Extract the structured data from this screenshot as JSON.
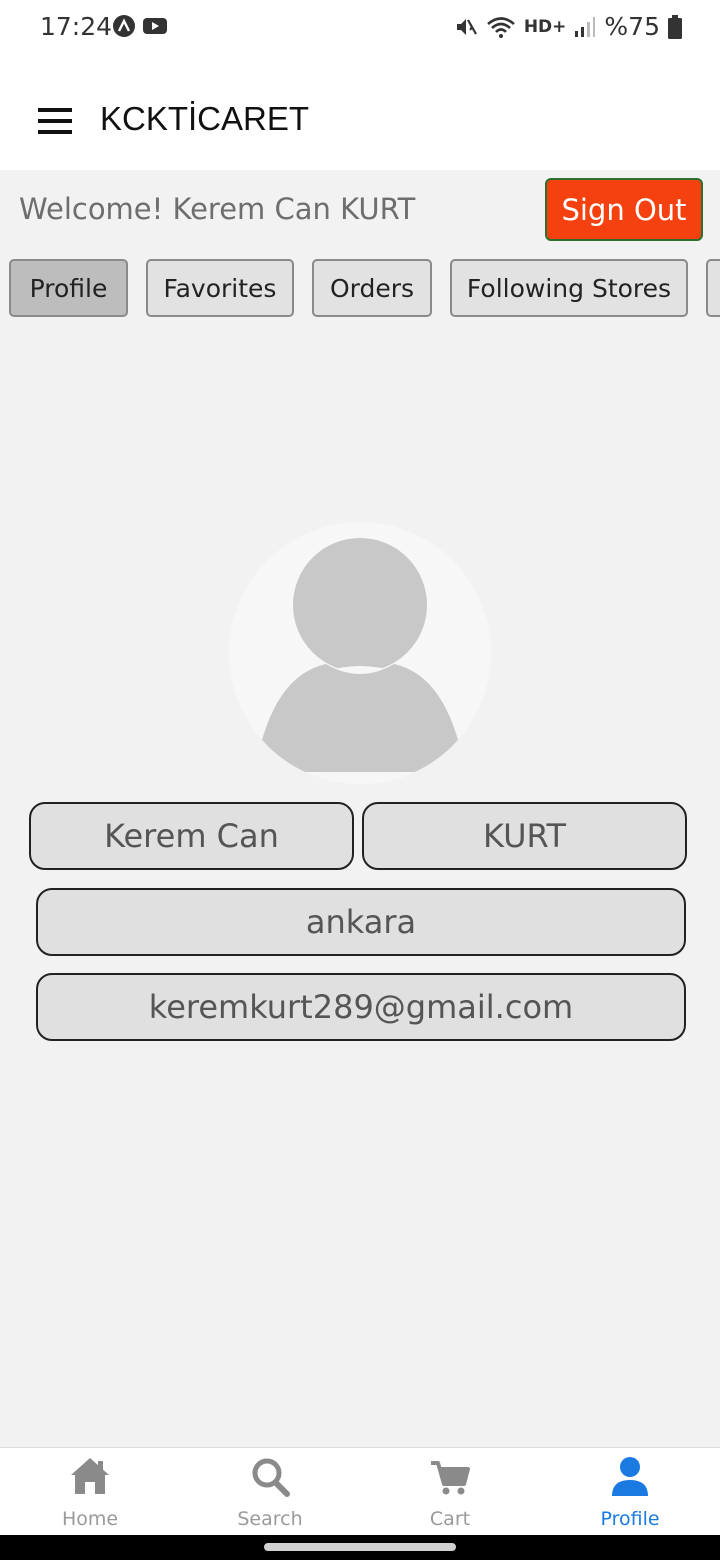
{
  "status_bar": {
    "time": "17:24",
    "network": "HD+",
    "battery": "%75"
  },
  "app_bar": {
    "title": "KCKTİCARET"
  },
  "welcome": {
    "text": "Welcome! Kerem Can KURT",
    "sign_out_label": "Sign Out"
  },
  "tabs": [
    {
      "label": "Profile",
      "active": true
    },
    {
      "label": "Favorites",
      "active": false
    },
    {
      "label": "Orders",
      "active": false
    },
    {
      "label": "Following Stores",
      "active": false
    }
  ],
  "profile": {
    "first_name": "Kerem Can",
    "last_name": "KURT",
    "city": "ankara",
    "email": "keremkurt289@gmail.com"
  },
  "bottom_nav": [
    {
      "label": "Home",
      "icon": "home-icon"
    },
    {
      "label": "Search",
      "icon": "search-icon"
    },
    {
      "label": "Cart",
      "icon": "cart-icon"
    },
    {
      "label": "Profile",
      "icon": "person-icon",
      "active": true
    }
  ],
  "colors": {
    "sign_out": "#f4410f",
    "active_nav": "#1a7ae2"
  }
}
